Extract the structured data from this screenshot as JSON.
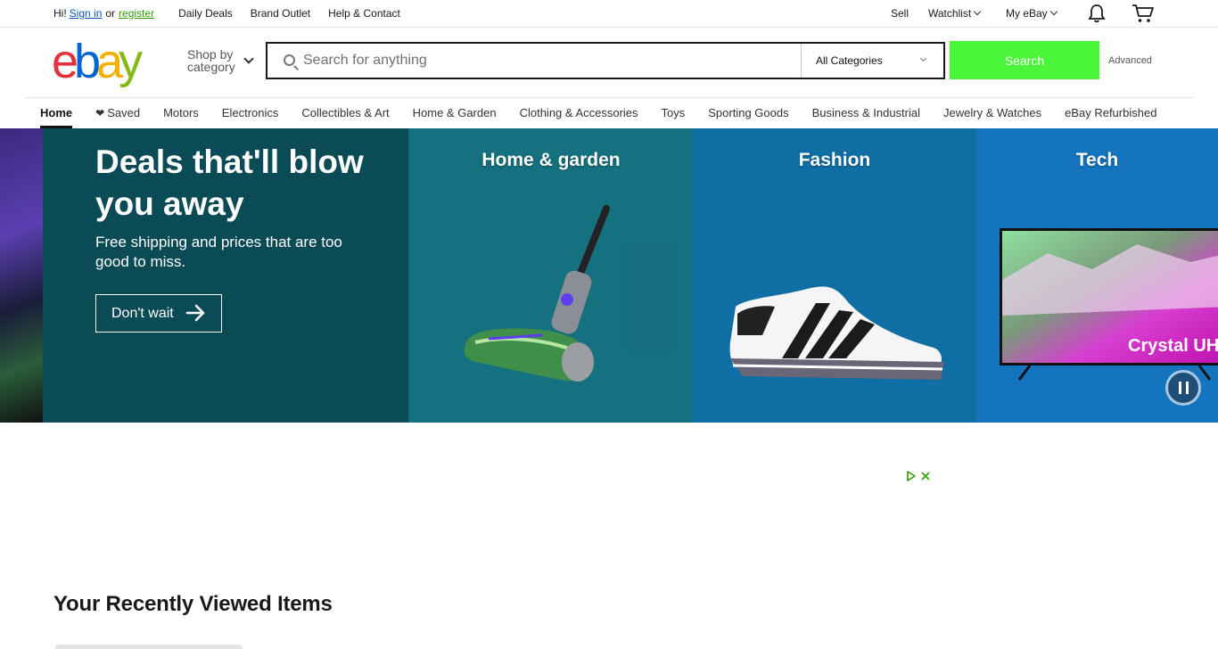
{
  "topbar": {
    "greeting": "Hi!",
    "sign_in": "Sign in",
    "or": "or",
    "register": "register",
    "links": [
      "Daily Deals",
      "Brand Outlet",
      "Help & Contact"
    ],
    "sell": "Sell",
    "watchlist": "Watchlist",
    "my_ebay": "My eBay",
    "notification_icon": "bell-icon",
    "cart_icon": "cart-icon"
  },
  "header": {
    "logo": {
      "e": "e",
      "b": "b",
      "a": "a",
      "y": "y"
    },
    "shop_by_line1": "Shop by",
    "shop_by_line2": "category",
    "search_placeholder": "Search for anything",
    "category_selected": "All Categories",
    "search_button": "Search",
    "advanced": "Advanced"
  },
  "nav": {
    "items": [
      "Home",
      "Saved",
      "Motors",
      "Electronics",
      "Collectibles & Art",
      "Home & Garden",
      "Clothing & Accessories",
      "Toys",
      "Sporting Goods",
      "Business & Industrial",
      "Jewelry & Watches",
      "eBay Refurbished"
    ]
  },
  "hero": {
    "headline": "Deals that'll blow you away",
    "subtext": "Free shipping and prices that are too good to miss.",
    "cta": "Don't wait",
    "tiles": [
      {
        "title": "Home & garden"
      },
      {
        "title": "Fashion"
      },
      {
        "title": "Tech",
        "tv_text": "Crystal UH"
      }
    ]
  },
  "recent": {
    "title": "Your Recently Viewed Items"
  },
  "colors": {
    "search_button": "#4bf53a",
    "promo_bg": "#0a4b56",
    "link_blue": "#0654ba",
    "register_green": "#2f9e00"
  }
}
